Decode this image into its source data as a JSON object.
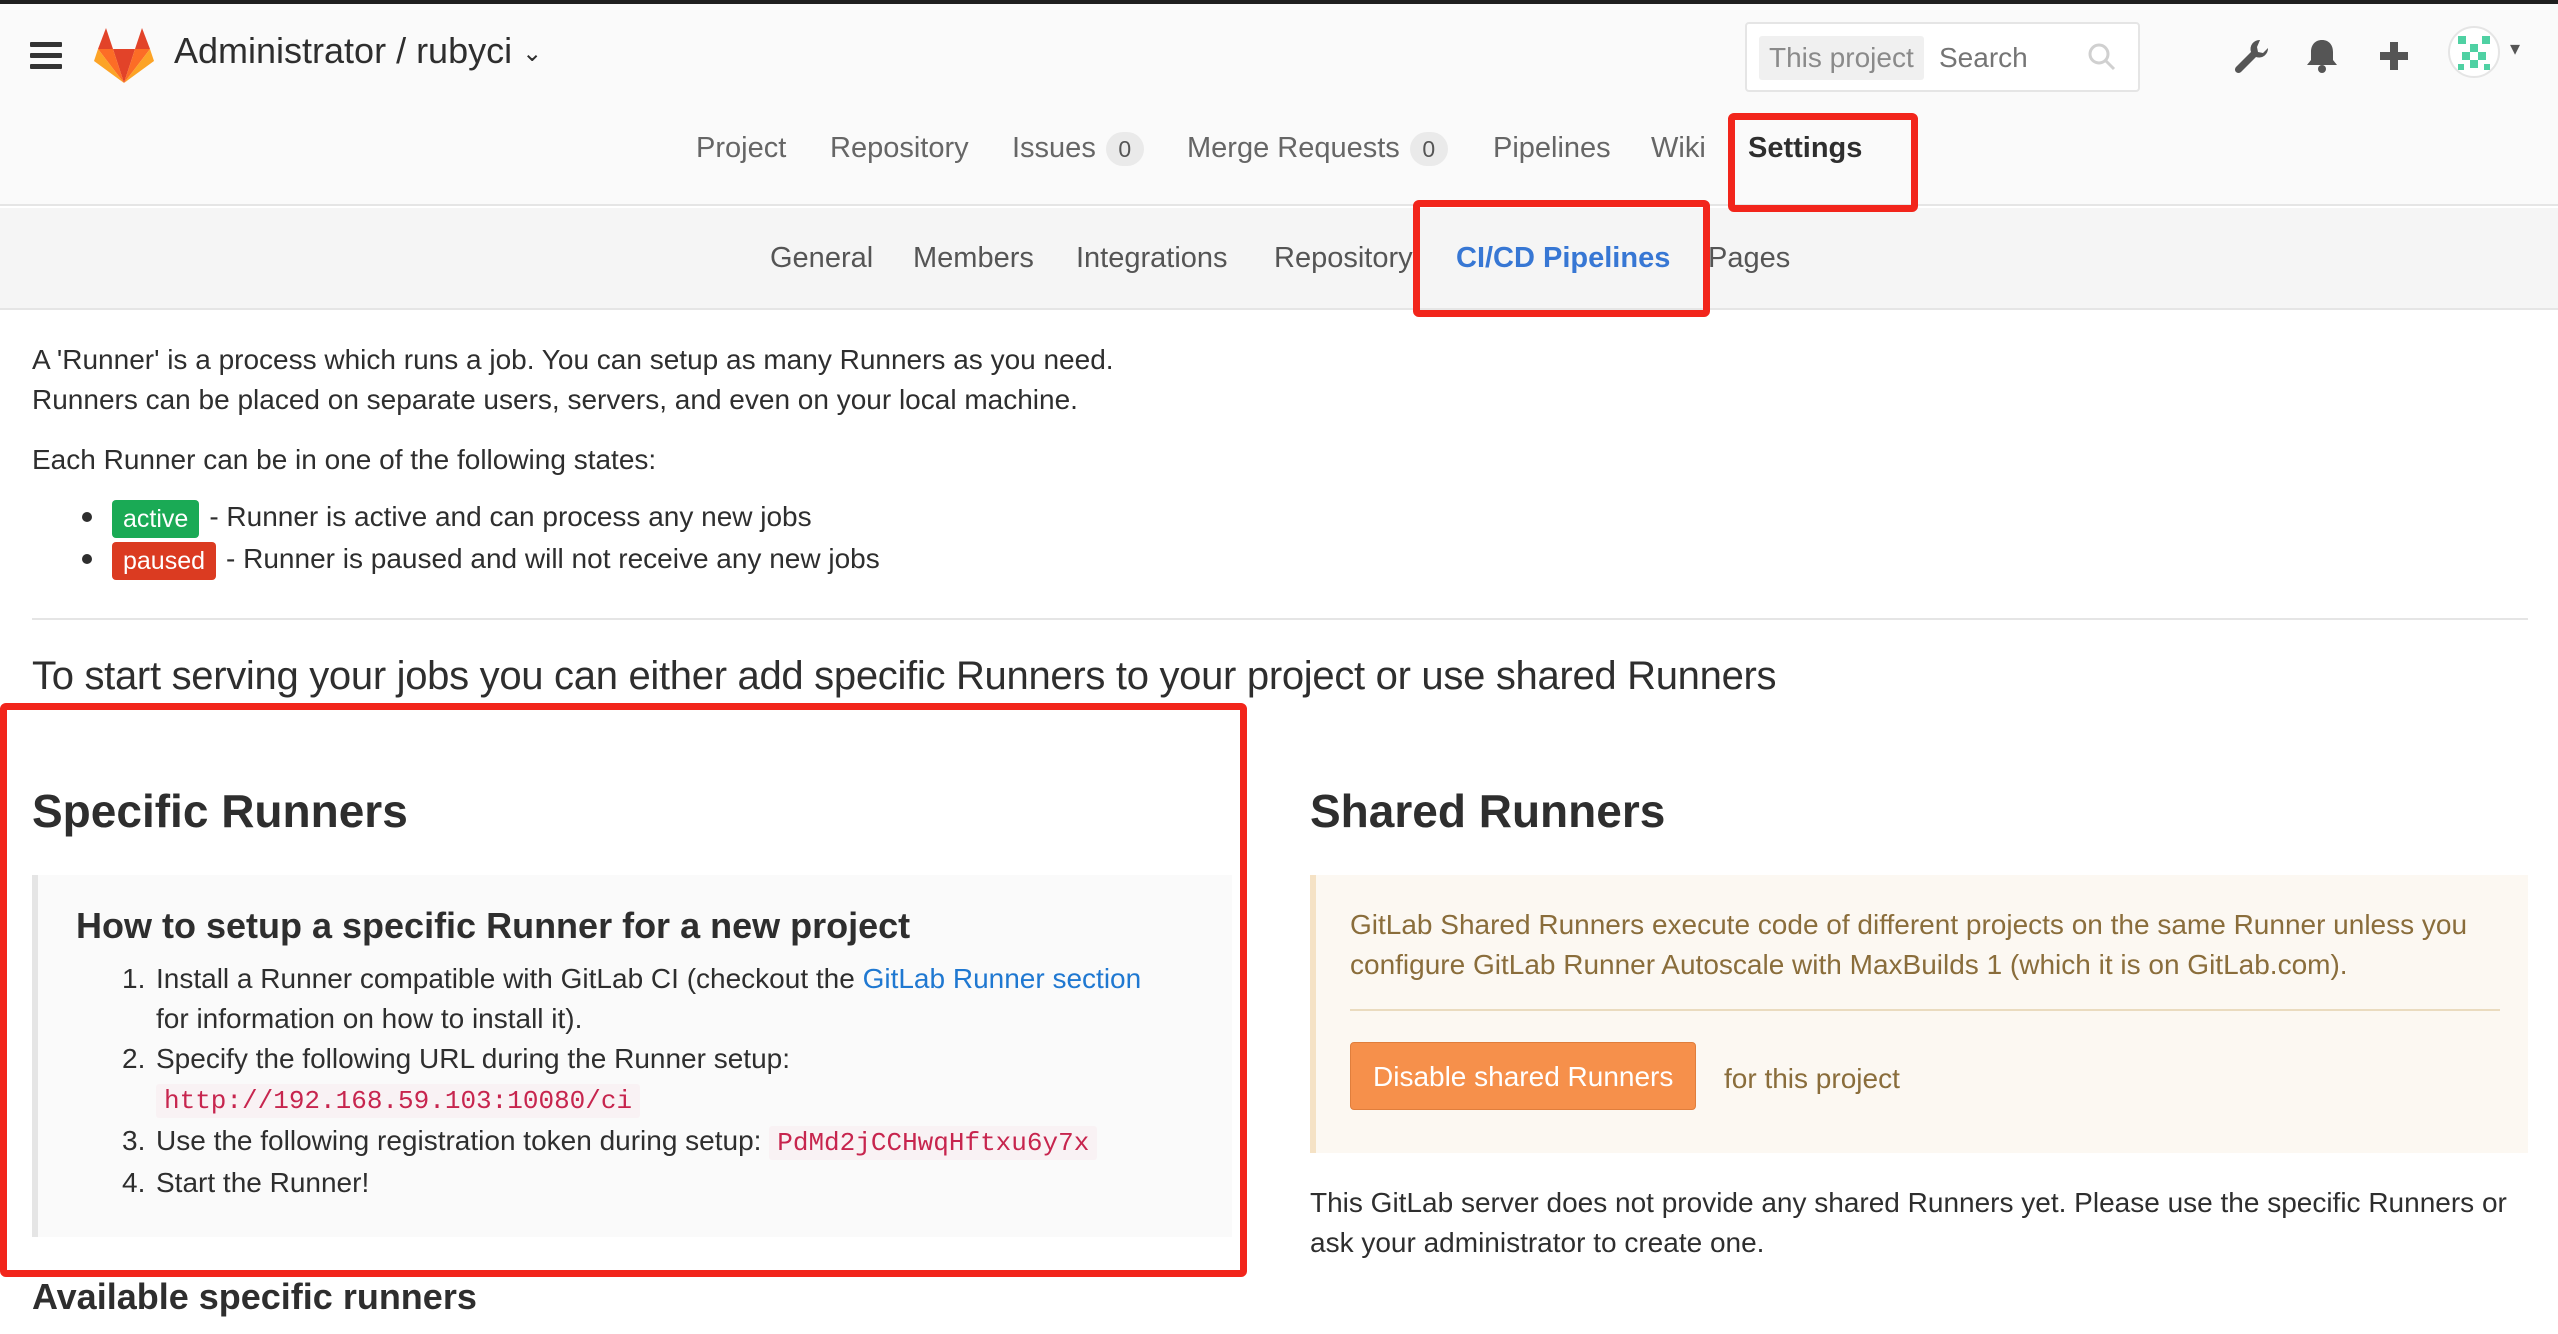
{
  "header": {
    "project_title": "Administrator / rubyci",
    "search": {
      "scope": "This project",
      "placeholder": "Search"
    },
    "icons": [
      "menu-icon",
      "gitlab-logo",
      "wrench-icon",
      "bell-icon",
      "plus-icon",
      "user-avatar"
    ]
  },
  "main_nav": [
    {
      "label": "Project"
    },
    {
      "label": "Repository"
    },
    {
      "label": "Issues",
      "count": "0"
    },
    {
      "label": "Merge Requests",
      "count": "0"
    },
    {
      "label": "Pipelines"
    },
    {
      "label": "Wiki"
    },
    {
      "label": "Settings",
      "active": true
    }
  ],
  "sub_nav": [
    {
      "label": "General"
    },
    {
      "label": "Members"
    },
    {
      "label": "Integrations"
    },
    {
      "label": "Repository"
    },
    {
      "label": "CI/CD Pipelines",
      "active": true
    },
    {
      "label": "Pages"
    }
  ],
  "intro": {
    "line1": "A 'Runner' is a process which runs a job. You can setup as many Runners as you need.",
    "line2": "Runners can be placed on separate users, servers, and even on your local machine.",
    "states_intro": "Each Runner can be in one of the following states:",
    "states": [
      {
        "badge": "active",
        "text": "- Runner is active and can process any new jobs",
        "color": "#1aaa55"
      },
      {
        "badge": "paused",
        "text": "- Runner is paused and will not receive any new jobs",
        "color": "#db3b21"
      }
    ]
  },
  "lead": "To start serving your jobs you can either add specific Runners to your project or use shared Runners",
  "specific": {
    "heading": "Specific Runners",
    "setup_title": "How to setup a specific Runner for a new project",
    "step1_a": "Install a Runner compatible with GitLab CI (checkout the ",
    "step1_link": "GitLab Runner section",
    "step1_b": "for information on how to install it).",
    "step2": "Specify the following URL during the Runner setup:",
    "step2_code": "http://192.168.59.103:10080/ci",
    "step3": "Use the following registration token during setup:",
    "step3_code": "PdMd2jCCHwqHftxu6y7x",
    "step4": "Start the Runner!",
    "available_heading": "Available specific runners"
  },
  "shared": {
    "heading": "Shared Runners",
    "warning": "GitLab Shared Runners execute code of different projects on the same Runner unless you configure GitLab Runner Autoscale with MaxBuilds 1 (which it is on GitLab.com).",
    "disable_button": "Disable shared Runners",
    "for_project": "for this project",
    "note": "This GitLab server does not provide any shared Runners yet. Please use the specific Runners or ask your administrator to create one."
  },
  "colors": {
    "accent_link": "#1f78d1",
    "active_subnav": "#3777d4",
    "annotation": "#f2251b",
    "disable_button": "#f6904b"
  }
}
